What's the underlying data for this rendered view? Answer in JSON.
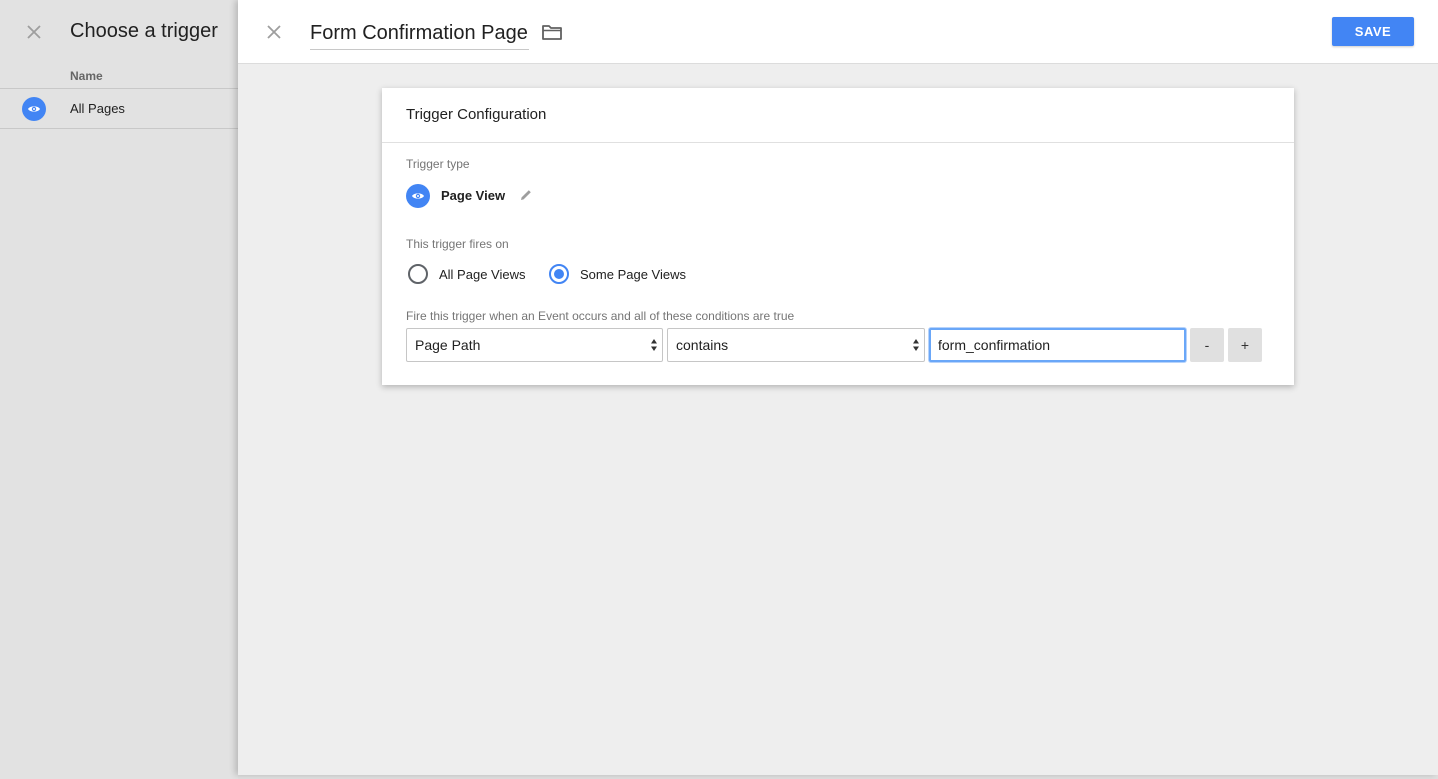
{
  "left_panel": {
    "title": "Choose a trigger",
    "column_header": "Name",
    "triggers": [
      {
        "label": "All Pages",
        "icon": "eye-icon"
      }
    ]
  },
  "editor": {
    "trigger_name": "Form Confirmation Page",
    "save_label": "SAVE",
    "card_title": "Trigger Configuration",
    "trigger_type_label": "Trigger type",
    "trigger_type_name": "Page View",
    "fires_on_label": "This trigger fires on",
    "fires_on_options": [
      {
        "label": "All Page Views",
        "selected": false
      },
      {
        "label": "Some Page Views",
        "selected": true
      }
    ],
    "condition_label": "Fire this trigger when an Event occurs and all of these conditions are true",
    "condition": {
      "variable": "Page Path",
      "operator": "contains",
      "value": "form_confirmation"
    },
    "remove_label": "-",
    "add_label": "+"
  },
  "colors": {
    "accent": "#4285f4",
    "panel_bg": "#e2e2e2",
    "main_bg": "#eeeeee"
  }
}
